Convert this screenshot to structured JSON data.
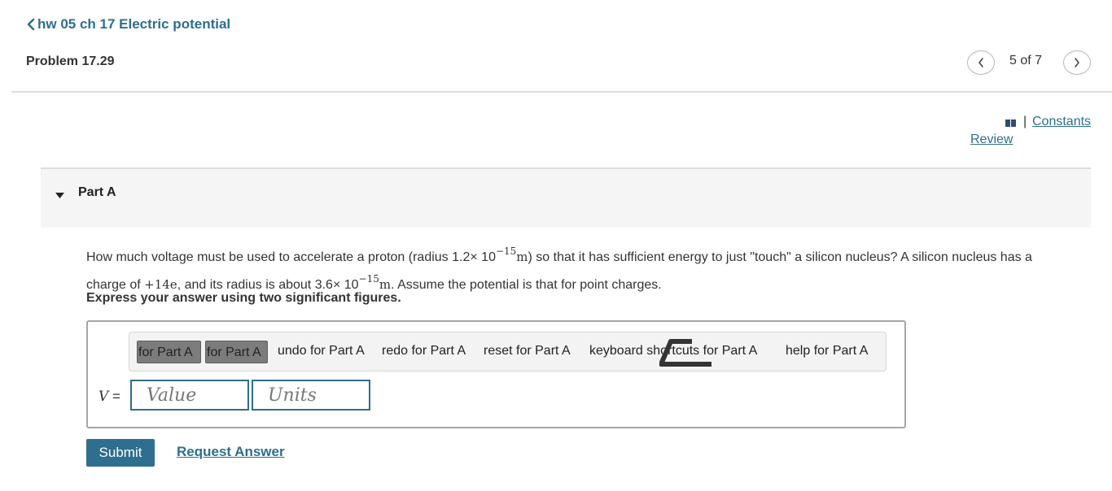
{
  "header": {
    "back_label": "hw 05 ch 17 Electric potential",
    "problem_title": "Problem 17.29",
    "pager": {
      "current": "5 of 7"
    }
  },
  "resources": {
    "separator": "|",
    "constants": "Constants",
    "review": "Review"
  },
  "part": {
    "label": "Part A"
  },
  "question": {
    "p1": "How much voltage must be used to accelerate a proton (radius 1.2",
    "times": "×",
    "ten": " 10",
    "exp1": "−15",
    "unit1": "m",
    "p2": ") so that it has sufficient energy to just \"touch\" a silicon nucleus? A silicon nucleus has a charge of ",
    "charge": "+14e",
    "p3": ", and its radius is about 3.6",
    "exp2": "−15",
    "unit2": "m",
    "p4": ". Assume the potential is that for point charges."
  },
  "instruction": "Express your answer using two significant figures.",
  "toolbar": {
    "btn1": "for Part A",
    "btn2": "for Part A",
    "undo": "undo for Part A",
    "redo": "redo for Part A",
    "reset": "reset for Part A",
    "keyboard_shortcuts": "keyboard shortcuts for Part A",
    "help": "help for Part A"
  },
  "answer": {
    "variable": "V",
    "equals": " =",
    "value_placeholder": "Value",
    "units_placeholder": "Units"
  },
  "actions": {
    "submit": "Submit",
    "request_answer": "Request Answer"
  },
  "colors": {
    "link": "#2e6e8e",
    "button": "#2e6e8e",
    "field_border": "#2e6e8e"
  }
}
